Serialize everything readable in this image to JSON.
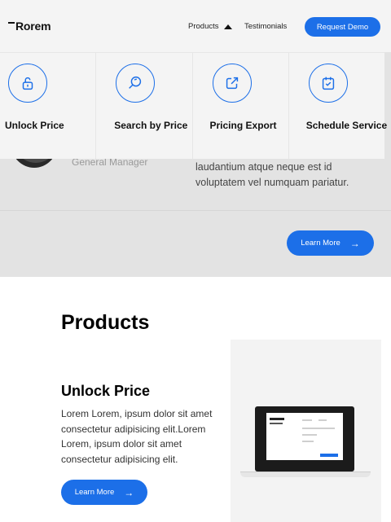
{
  "header": {
    "logo": "Rorem",
    "nav": {
      "products_label": "Products",
      "testimonials_label": "Testimonials"
    },
    "request_demo_label": "Request Demo"
  },
  "dropdown": {
    "items": [
      {
        "label": "Unlock Price",
        "icon": "unlock-icon"
      },
      {
        "label": "Search by Price",
        "icon": "search-icon"
      },
      {
        "label": "Pricing Export",
        "icon": "export-icon"
      },
      {
        "label": "Schedule Service",
        "icon": "calendar-check-icon"
      }
    ]
  },
  "testimonial": {
    "role": "General Manager",
    "quote": "laudantium atque neque est id voluptatem vel numquam pariatur.",
    "learn_more_label": "Learn More"
  },
  "products": {
    "title": "Products",
    "item": {
      "name": "Unlock Price",
      "description": "Lorem Lorem, ipsum dolor sit amet consectetur adipisicing elit.Lorem Lorem, ipsum dolor sit amet consectetur adipisicing elit.",
      "learn_more_label": "Learn More"
    }
  },
  "colors": {
    "accent": "#1c6fe8",
    "header_bg": "#f4f4f4",
    "band_bg": "#e3e3e3"
  }
}
